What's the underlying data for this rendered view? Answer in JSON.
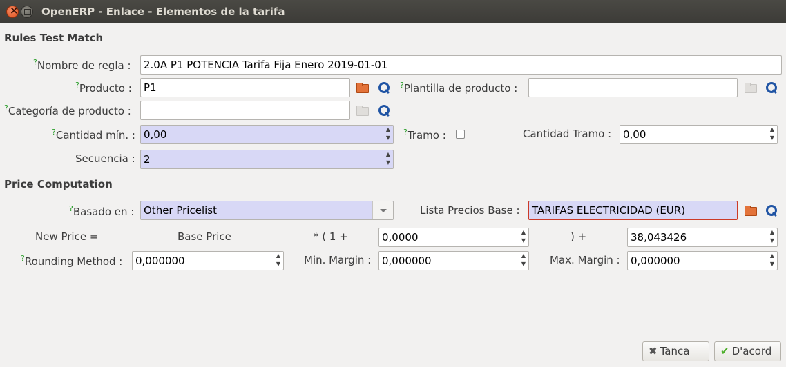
{
  "window": {
    "title": "OpenERP - Enlace - Elementos de la tarifa"
  },
  "sections": {
    "rules": "Rules Test Match",
    "price": "Price Computation"
  },
  "rules": {
    "nombre_label": "Nombre de regla :",
    "nombre_value": "2.0A P1 POTENCIA Tarifa Fija Enero 2019-01-01",
    "producto_label": "Producto :",
    "producto_value": "P1",
    "plantilla_label": "Plantilla de producto :",
    "plantilla_value": "",
    "categoria_label": "Categoría de producto :",
    "categoria_value": "",
    "cantidad_label": "Cantidad mín. :",
    "cantidad_value": "0,00",
    "tramo_label": "Tramo :",
    "tramo_checked": false,
    "cantidad_tramo_label": "Cantidad Tramo :",
    "cantidad_tramo_value": "0,00",
    "secuencia_label": "Secuencia :",
    "secuencia_value": "2"
  },
  "price": {
    "basado_label": "Basado en :",
    "basado_value": "Other Pricelist",
    "lista_label": "Lista Precios Base :",
    "lista_value": "TARIFAS ELECTRICIDAD (EUR)",
    "new_price": "New Price =",
    "base_price": "Base Price",
    "mult": "* ( 1 +",
    "discount_value": "0,0000",
    "close_plus": ") +",
    "surcharge_value": "38,043426",
    "rounding_label": "Rounding Method :",
    "rounding_value": "0,000000",
    "min_margin_label": "Min. Margin :",
    "min_margin_value": "0,000000",
    "max_margin_label": "Max. Margin :",
    "max_margin_value": "0,000000"
  },
  "buttons": {
    "cancel": "Tanca",
    "ok": "D'acord"
  },
  "help_mark": "?"
}
